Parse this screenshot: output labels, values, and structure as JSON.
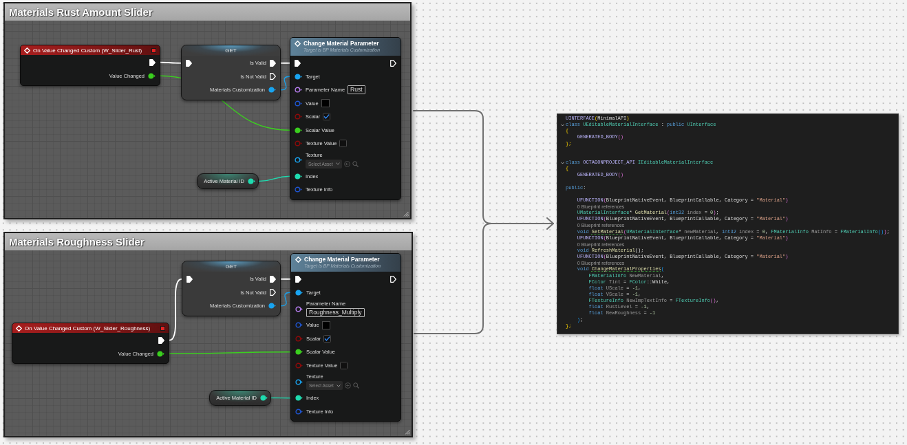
{
  "panels": [
    {
      "title": "Materials Rust Amount Slider",
      "nodes": [
        {
          "kind": "event",
          "title": "On Value Changed Custom (W_Slider_Rust)",
          "outputs": [
            {
              "kind": "exec",
              "connected": true
            },
            {
              "label": "Value Changed",
              "kind": "float",
              "connected": true
            }
          ]
        },
        {
          "kind": "get",
          "title": "GET",
          "inputs": [
            {
              "kind": "exec",
              "connected": true
            }
          ],
          "outputs": [
            {
              "label": "Is Valid",
              "kind": "exec",
              "connected": true
            },
            {
              "label": "Is Not Valid",
              "kind": "exec",
              "connected": false
            },
            {
              "label": "Materials Customization",
              "kind": "object",
              "connected": true
            }
          ]
        },
        {
          "kind": "function",
          "title": "Change Material Parameter",
          "subtitle": "Target is BP Materials Customization",
          "inputs": [
            {
              "kind": "exec",
              "connected": true
            },
            {
              "label": "Target",
              "kind": "object",
              "connected": true
            },
            {
              "label": "Parameter Name",
              "kind": "name",
              "connected": false,
              "value": "Rust"
            },
            {
              "label": "Value",
              "kind": "struct",
              "connected": false,
              "color": "#000000"
            },
            {
              "label": "Scalar",
              "kind": "bool",
              "connected": false,
              "checked": true
            },
            {
              "label": "Scalar Value",
              "kind": "float",
              "connected": true
            },
            {
              "label": "Texture Value",
              "kind": "bool",
              "connected": false,
              "checked": false
            },
            {
              "label": "Texture",
              "kind": "object",
              "connected": false,
              "placeholder": "Select Asset"
            },
            {
              "label": "Index",
              "kind": "int",
              "connected": true
            },
            {
              "label": "Texture Info",
              "kind": "struct",
              "connected": false
            }
          ],
          "outputs": [
            {
              "kind": "exec",
              "connected": false
            }
          ]
        },
        {
          "kind": "variable",
          "title": "Active Material ID",
          "outputs": [
            {
              "kind": "int",
              "connected": true
            }
          ]
        }
      ]
    },
    {
      "title": "Materials Roughness Slider",
      "nodes": [
        {
          "kind": "get",
          "title": "GET",
          "inputs": [
            {
              "kind": "exec",
              "connected": true
            }
          ],
          "outputs": [
            {
              "label": "Is Valid",
              "kind": "exec",
              "connected": true
            },
            {
              "label": "Is Not Valid",
              "kind": "exec",
              "connected": false
            },
            {
              "label": "Materials Customization",
              "kind": "object",
              "connected": true
            }
          ]
        },
        {
          "kind": "function",
          "title": "Change Material Parameter",
          "subtitle": "Target is BP Materials Customization",
          "inputs": [
            {
              "kind": "exec",
              "connected": true
            },
            {
              "label": "Target",
              "kind": "object",
              "connected": true
            },
            {
              "label": "Parameter Name",
              "kind": "name",
              "connected": false,
              "value": "Roughness_Multiply"
            },
            {
              "label": "Value",
              "kind": "struct",
              "connected": false,
              "color": "#000000"
            },
            {
              "label": "Scalar",
              "kind": "bool",
              "connected": false,
              "checked": true
            },
            {
              "label": "Scalar Value",
              "kind": "float",
              "connected": true
            },
            {
              "label": "Texture Value",
              "kind": "bool",
              "connected": false,
              "checked": false
            },
            {
              "label": "Texture",
              "kind": "object",
              "connected": false,
              "placeholder": "Select Asset"
            },
            {
              "label": "Index",
              "kind": "int",
              "connected": true
            },
            {
              "label": "Texture Info",
              "kind": "struct",
              "connected": false
            }
          ],
          "outputs": [
            {
              "kind": "exec",
              "connected": false
            }
          ]
        },
        {
          "kind": "event",
          "title": "On Value Changed Custom (W_Slider_Roughness)",
          "outputs": [
            {
              "kind": "exec",
              "connected": true
            },
            {
              "label": "Value Changed",
              "kind": "float",
              "connected": true
            }
          ]
        },
        {
          "kind": "variable",
          "title": "Active Material ID",
          "outputs": [
            {
              "kind": "int",
              "connected": true
            }
          ]
        }
      ]
    }
  ],
  "code_editor": {
    "lines": [
      {
        "kind": "code",
        "tokens": [
          {
            "text": "UINTERFACE",
            "kind": "macro"
          },
          {
            "text": "(",
            "kind": "brace"
          },
          {
            "text": "MinimalAPI",
            "kind": "plain"
          },
          {
            "text": ")",
            "kind": "brace"
          }
        ]
      },
      {
        "kind": "fold",
        "tokens": [
          {
            "text": "class",
            "kind": "keyword"
          },
          {
            "text": " UEditableMaterialInterface",
            "kind": "type"
          },
          {
            "text": " : ",
            "kind": "plain"
          },
          {
            "text": "public",
            "kind": "keyword"
          },
          {
            "text": " UInterface",
            "kind": "type"
          }
        ]
      },
      {
        "kind": "code",
        "tokens": [
          {
            "text": "{",
            "kind": "brace"
          }
        ]
      },
      {
        "kind": "code",
        "tokens": [
          {
            "text": "    GENERATED_BODY",
            "kind": "macro"
          },
          {
            "text": "()",
            "kind": "paren"
          }
        ]
      },
      {
        "kind": "code",
        "tokens": [
          {
            "text": "};",
            "kind": "brace"
          }
        ]
      },
      {
        "kind": "blank"
      },
      {
        "kind": "blank"
      },
      {
        "kind": "fold",
        "tokens": [
          {
            "text": "class",
            "kind": "keyword"
          },
          {
            "text": " OCTAGONPROJECT_API",
            "kind": "macro"
          },
          {
            "text": " IEditableMaterialInterface",
            "kind": "type"
          }
        ]
      },
      {
        "kind": "code",
        "tokens": [
          {
            "text": "{",
            "kind": "brace"
          }
        ]
      },
      {
        "kind": "code",
        "tokens": [
          {
            "text": "    GENERATED_BODY",
            "kind": "macro"
          },
          {
            "text": "()",
            "kind": "paren"
          }
        ]
      },
      {
        "kind": "blank"
      },
      {
        "kind": "code",
        "tokens": [
          {
            "text": "public",
            "kind": "keyword"
          },
          {
            "text": ":",
            "kind": "plain"
          }
        ]
      },
      {
        "kind": "blank"
      },
      {
        "kind": "code",
        "tokens": [
          {
            "text": "    UFUNCTION",
            "kind": "macro"
          },
          {
            "text": "(",
            "kind": "paren"
          },
          {
            "text": "BlueprintNativeEvent, BlueprintCallable, Category = ",
            "kind": "plain"
          },
          {
            "text": "\"Material\"",
            "kind": "string"
          },
          {
            "text": ")",
            "kind": "paren"
          }
        ]
      },
      {
        "kind": "lens",
        "text": "0 Blueprint references"
      },
      {
        "kind": "code",
        "tokens": [
          {
            "text": "    UMaterialInterface",
            "kind": "type"
          },
          {
            "text": "* ",
            "kind": "plain"
          },
          {
            "text": "GetMaterial",
            "kind": "function"
          },
          {
            "text": "(",
            "kind": "paren"
          },
          {
            "text": "int32",
            "kind": "keyword"
          },
          {
            "text": " index",
            "kind": "param"
          },
          {
            "text": " = ",
            "kind": "plain"
          },
          {
            "text": "0",
            "kind": "number"
          },
          {
            "text": ")",
            "kind": "paren"
          },
          {
            "text": ";",
            "kind": "plain"
          }
        ]
      },
      {
        "kind": "code",
        "tokens": [
          {
            "text": "    UFUNCTION",
            "kind": "macro"
          },
          {
            "text": "(",
            "kind": "paren"
          },
          {
            "text": "BlueprintNativeEvent, BlueprintCallable, Category = ",
            "kind": "plain"
          },
          {
            "text": "\"Material\"",
            "kind": "string"
          },
          {
            "text": ")",
            "kind": "paren"
          }
        ]
      },
      {
        "kind": "lens",
        "text": "0 Blueprint references"
      },
      {
        "kind": "code",
        "tokens": [
          {
            "text": "    void ",
            "kind": "keyword"
          },
          {
            "text": "SetMaterial",
            "kind": "function_warn"
          },
          {
            "text": "(",
            "kind": "paren"
          },
          {
            "text": "UMaterialInterface",
            "kind": "type"
          },
          {
            "text": "* ",
            "kind": "plain"
          },
          {
            "text": "newMaterial",
            "kind": "param"
          },
          {
            "text": ", ",
            "kind": "plain"
          },
          {
            "text": "int32",
            "kind": "keyword"
          },
          {
            "text": " index",
            "kind": "param"
          },
          {
            "text": " = ",
            "kind": "plain"
          },
          {
            "text": "0",
            "kind": "number"
          },
          {
            "text": ", ",
            "kind": "plain"
          },
          {
            "text": "FMaterialInfo",
            "kind": "type"
          },
          {
            "text": " MatInfo",
            "kind": "param"
          },
          {
            "text": " = ",
            "kind": "plain"
          },
          {
            "text": "FMaterialInfo",
            "kind": "type"
          },
          {
            "text": "()",
            "kind": "paren_inner"
          },
          {
            "text": ")",
            "kind": "paren"
          },
          {
            "text": ";",
            "kind": "plain"
          }
        ]
      },
      {
        "kind": "code",
        "tokens": [
          {
            "text": "    UFUNCTION",
            "kind": "macro"
          },
          {
            "text": "(",
            "kind": "paren"
          },
          {
            "text": "BlueprintNativeEvent, BlueprintCallable, Category = ",
            "kind": "plain"
          },
          {
            "text": "\"Material\"",
            "kind": "string"
          },
          {
            "text": ")",
            "kind": "paren"
          }
        ]
      },
      {
        "kind": "lens",
        "text": "0 Blueprint references"
      },
      {
        "kind": "code",
        "tokens": [
          {
            "text": "    void ",
            "kind": "keyword"
          },
          {
            "text": "RefreshMaterial",
            "kind": "function"
          },
          {
            "text": "();",
            "kind": "plain"
          }
        ]
      },
      {
        "kind": "code",
        "tokens": [
          {
            "text": "    UFUNCTION",
            "kind": "macro"
          },
          {
            "text": "(",
            "kind": "paren"
          },
          {
            "text": "BlueprintNativeEvent, BlueprintCallable, Category = ",
            "kind": "plain"
          },
          {
            "text": "\"Material\"",
            "kind": "string"
          },
          {
            "text": ")",
            "kind": "paren"
          }
        ]
      },
      {
        "kind": "lens",
        "text": "0 Blueprint references"
      },
      {
        "kind": "code",
        "tokens": [
          {
            "text": "    void ",
            "kind": "keyword"
          },
          {
            "text": "ChangeMaterialProperties",
            "kind": "function_warn"
          },
          {
            "text": "(",
            "kind": "paren_inner"
          }
        ]
      },
      {
        "kind": "code",
        "tokens": [
          {
            "text": "        FMaterialInfo",
            "kind": "type"
          },
          {
            "text": " NewMaterial",
            "kind": "param"
          },
          {
            "text": ",",
            "kind": "plain"
          }
        ]
      },
      {
        "kind": "code",
        "tokens": [
          {
            "text": "        FColor",
            "kind": "type"
          },
          {
            "text": " Tint",
            "kind": "param"
          },
          {
            "text": " = ",
            "kind": "plain"
          },
          {
            "text": "FColor",
            "kind": "type"
          },
          {
            "text": "::White,",
            "kind": "plain"
          }
        ]
      },
      {
        "kind": "code",
        "tokens": [
          {
            "text": "        float",
            "kind": "keyword"
          },
          {
            "text": " UScale",
            "kind": "param"
          },
          {
            "text": " = ",
            "kind": "plain"
          },
          {
            "text": "-1",
            "kind": "number"
          },
          {
            "text": ",",
            "kind": "plain"
          }
        ]
      },
      {
        "kind": "code",
        "tokens": [
          {
            "text": "        float",
            "kind": "keyword"
          },
          {
            "text": " VScale",
            "kind": "param"
          },
          {
            "text": " = ",
            "kind": "plain"
          },
          {
            "text": "-1",
            "kind": "number"
          },
          {
            "text": ",",
            "kind": "plain"
          }
        ]
      },
      {
        "kind": "code",
        "tokens": [
          {
            "text": "        FTextureInfo",
            "kind": "type"
          },
          {
            "text": " NewImpTextInfo",
            "kind": "param"
          },
          {
            "text": " = ",
            "kind": "plain"
          },
          {
            "text": "FTextureInfo",
            "kind": "type"
          },
          {
            "text": "()",
            "kind": "paren"
          },
          {
            "text": ",",
            "kind": "plain"
          }
        ]
      },
      {
        "kind": "code",
        "tokens": [
          {
            "text": "        float",
            "kind": "keyword"
          },
          {
            "text": " RustLevel",
            "kind": "param"
          },
          {
            "text": " = ",
            "kind": "plain"
          },
          {
            "text": "-1",
            "kind": "number"
          },
          {
            "text": ",",
            "kind": "plain"
          }
        ]
      },
      {
        "kind": "code",
        "tokens": [
          {
            "text": "        float",
            "kind": "keyword"
          },
          {
            "text": " NewRoughness",
            "kind": "param"
          },
          {
            "text": " = ",
            "kind": "plain"
          },
          {
            "text": "-1",
            "kind": "number"
          }
        ]
      },
      {
        "kind": "code",
        "tokens": [
          {
            "text": "    )",
            "kind": "paren_inner"
          },
          {
            "text": ";",
            "kind": "plain"
          }
        ]
      },
      {
        "kind": "code",
        "tokens": [
          {
            "text": "};",
            "kind": "brace"
          }
        ]
      }
    ]
  }
}
